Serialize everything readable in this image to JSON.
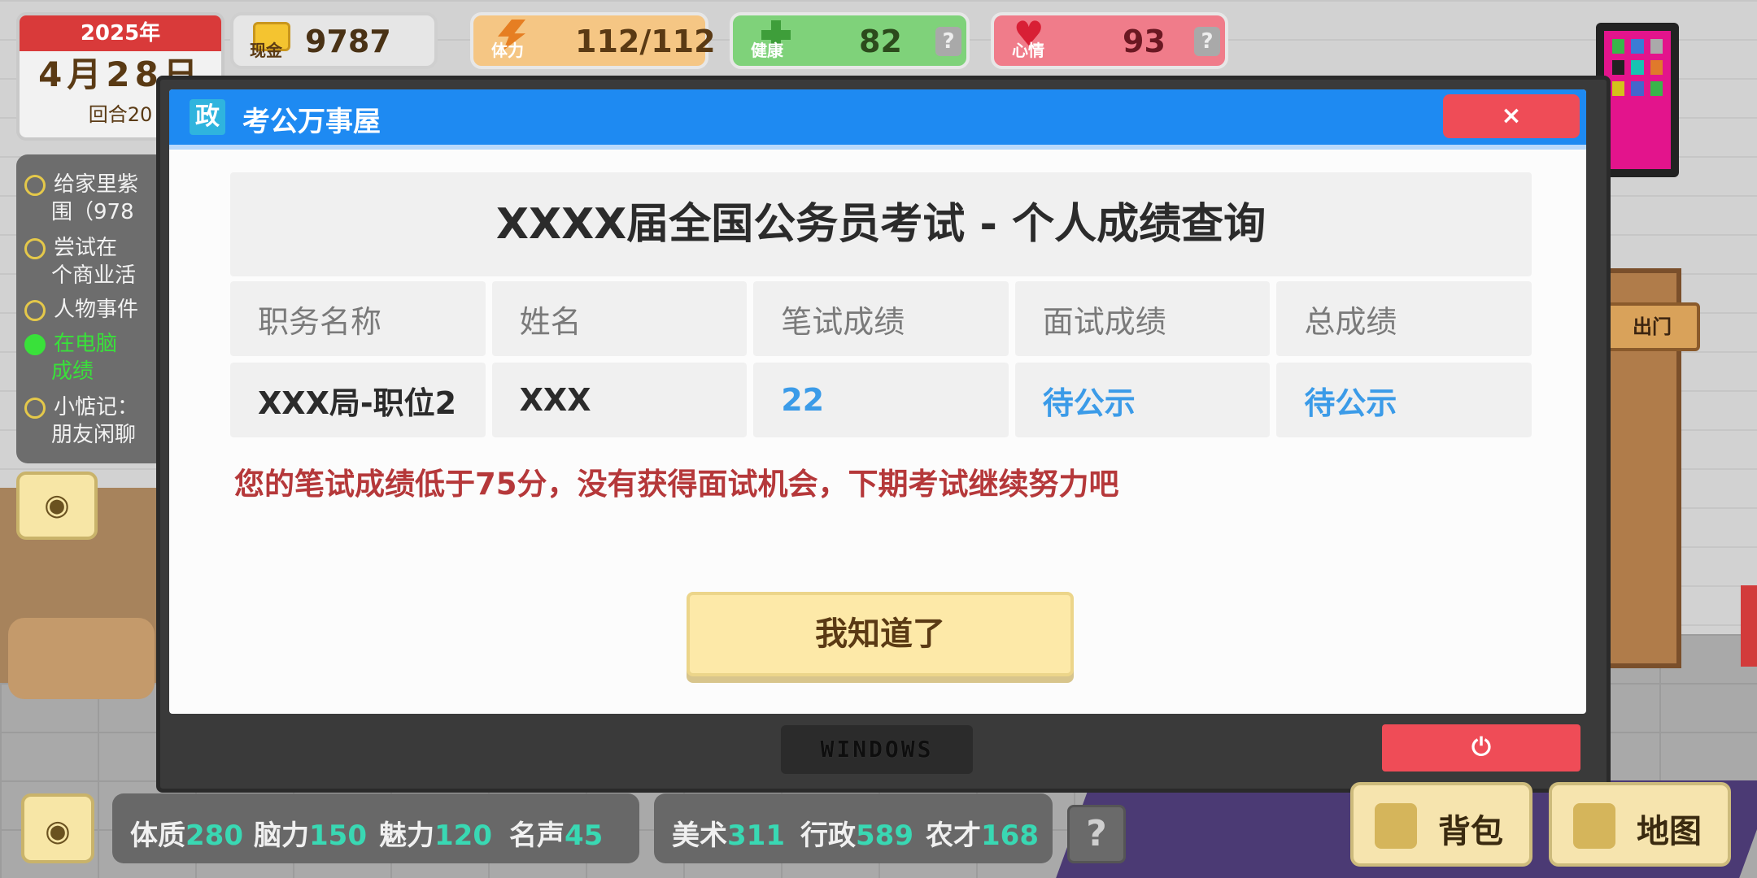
{
  "date": {
    "year": "2025年",
    "day": "4月28日",
    "turn": "回合20"
  },
  "stats": {
    "cash": {
      "label": "现金",
      "value": "9787"
    },
    "energy": {
      "label": "体力",
      "value": "112/112"
    },
    "health": {
      "label": "健康",
      "value": "82"
    },
    "mood": {
      "label": "心情",
      "value": "93"
    }
  },
  "quests": [
    {
      "text": "给家里紫",
      "sub": "围（978",
      "done": false
    },
    {
      "text": "尝试在",
      "sub": "个商业活",
      "done": false
    },
    {
      "text": "人物事件",
      "sub": "",
      "done": false
    },
    {
      "text": "在电脑",
      "sub": "成绩",
      "done": true
    },
    {
      "text": "小惦记：",
      "sub": "朋友闲聊",
      "done": false
    }
  ],
  "door_sign": "出门",
  "dialog": {
    "app_logo": "政",
    "app_title": "考公万事屋",
    "close_label": "×",
    "exam_title": "XXXX届全国公务员考试 - 个人成绩查询",
    "headers": [
      "职务名称",
      "姓名",
      "笔试成绩",
      "面试成绩",
      "总成绩"
    ],
    "row": [
      "XXX局-职位2",
      "XXX",
      "22",
      "待公示",
      "待公示"
    ],
    "notice": "您的笔试成绩低于75分，没有获得面试机会，下期考试继续努力吧",
    "ok_label": "我知道了"
  },
  "taskbar": {
    "windows_label": "WINDOWS",
    "power_label": "⏻"
  },
  "attributes": {
    "group1": [
      {
        "name": "体质",
        "value": "280"
      },
      {
        "name": "脑力",
        "value": "150"
      },
      {
        "name": "魅力",
        "value": "120"
      },
      {
        "name": "名声",
        "value": "45"
      }
    ],
    "group2": [
      {
        "name": "美术",
        "value": "311"
      },
      {
        "name": "行政",
        "value": "589"
      },
      {
        "name": "农才",
        "value": "168"
      }
    ]
  },
  "buttons": {
    "bag": "背包",
    "map": "地图",
    "help": "?"
  },
  "colors": {
    "titlebar": "#1e8af2",
    "close": "#ef4c57",
    "notice": "#b5383a",
    "pending": "#3b9be8",
    "phone": "#e3148c"
  }
}
